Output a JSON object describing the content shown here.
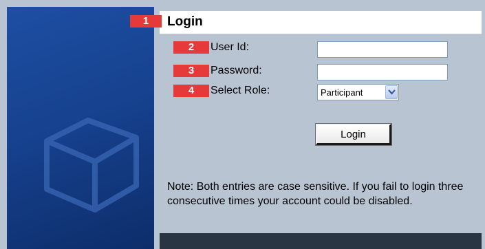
{
  "header": {
    "title": "Login"
  },
  "badges": [
    "1",
    "2",
    "3",
    "4"
  ],
  "form": {
    "user_id_label": "User Id:",
    "user_id_value": "",
    "password_label": "Password:",
    "password_value": "",
    "role_label": "Select Role:",
    "role_selected": "Participant",
    "login_button": "Login"
  },
  "note": "Note: Both entries are case sensitive. If you fail to login three consecutive times your account could be disabled.",
  "colors": {
    "badge": "#e63a3a",
    "background": "#b9c4d3",
    "left_panel": "#1e4ea3",
    "bottom_bar": "#2a3543"
  },
  "icons": [
    "cube-logo-icon",
    "chevron-down-icon"
  ]
}
